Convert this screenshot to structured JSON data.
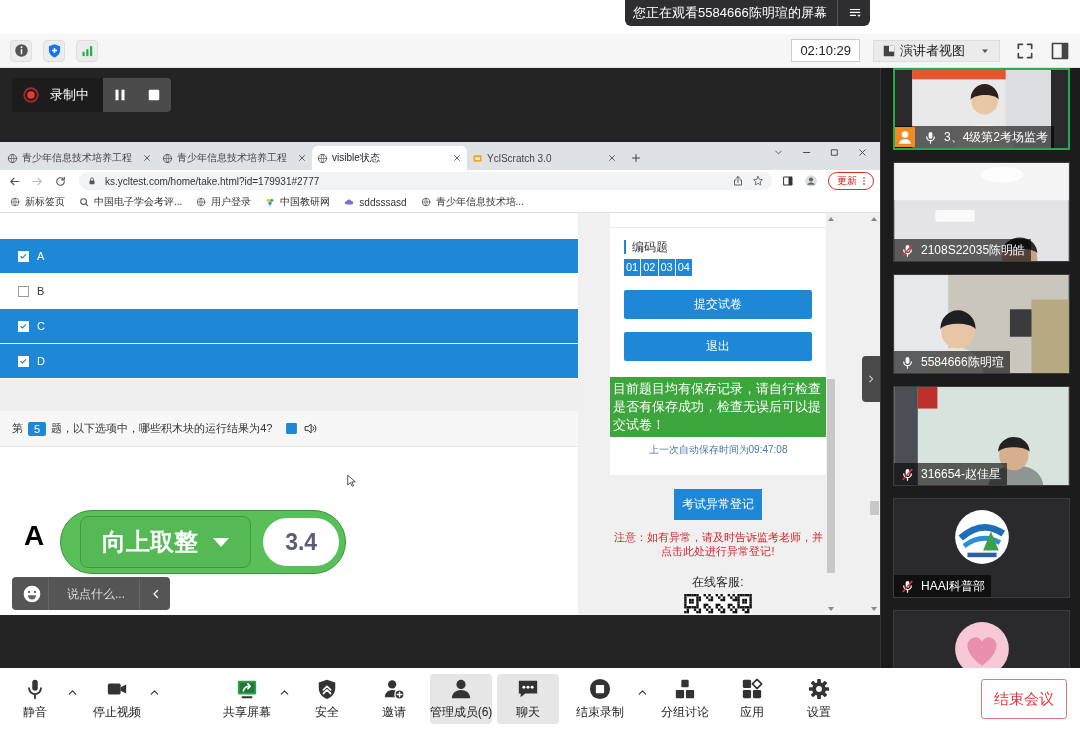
{
  "viewing_banner": {
    "text": "您正在观看5584666陈明瑄的屏幕"
  },
  "meeting_bar": {
    "timer": "02:10:29",
    "view_mode": "演讲者视图"
  },
  "recording": {
    "label": "录制中"
  },
  "browser": {
    "tabs": [
      {
        "title": "青少年信息技术培养工程",
        "kind": "globe",
        "selected": false
      },
      {
        "title": "青少年信息技术培养工程",
        "kind": "globe",
        "selected": false
      },
      {
        "title": "visible状态",
        "kind": "globe",
        "selected": true
      },
      {
        "title": "YclScratch 3.0",
        "kind": "app",
        "selected": false
      }
    ],
    "url": "ks.ycltest.com/home/take.html?id=179931#2777",
    "update_button": "更新",
    "bookmarks": [
      {
        "label": "新标签页",
        "kind": "globe"
      },
      {
        "label": "中国电子学会考评...",
        "kind": "magnifier"
      },
      {
        "label": "用户登录",
        "kind": "globe"
      },
      {
        "label": "中国教研网",
        "kind": "flower"
      },
      {
        "label": "sddsssasd",
        "kind": "cloud"
      },
      {
        "label": "青少年信息技术培...",
        "kind": "globe"
      }
    ]
  },
  "exam": {
    "options": [
      {
        "label": "A",
        "checked": true
      },
      {
        "label": "B",
        "checked": false
      },
      {
        "label": "C",
        "checked": true
      },
      {
        "label": "D",
        "checked": true
      }
    ],
    "question": {
      "prefix": "第",
      "number": "5",
      "text": "题，以下选项中，哪些积木块的运行结果为4?"
    },
    "answer_option": "A",
    "block": {
      "operator": "向上取整",
      "value": "3.4"
    },
    "chat_input": {
      "placeholder": "说点什么..."
    }
  },
  "side_panel": {
    "section_title": "编码题",
    "question_numbers": [
      "01",
      "02",
      "03",
      "04"
    ],
    "submit_button": "提交试卷",
    "exit_button": "退出",
    "save_notice": "目前题目均有保存记录，请自行检查是否有保存成功，检查无误后可以提交试卷！",
    "autosave_time": "上一次自动保存时间为09:47:08",
    "report_button": "考试异常登记",
    "warning": "注意：如有异常，请及时告诉监考老师，并点击此处进行异常登记!",
    "support_label": "在线客服:"
  },
  "participants": [
    {
      "name": "3、4级第2考场监考",
      "kind": "video",
      "muted": false,
      "host": true,
      "active": true
    },
    {
      "name": "2108S22035陈明皓",
      "kind": "video",
      "muted": true,
      "host": false,
      "active": false
    },
    {
      "name": "5584666陈明瑄",
      "kind": "video",
      "muted": false,
      "host": false,
      "active": false
    },
    {
      "name": "316654-赵佳星",
      "kind": "video",
      "muted": true,
      "host": false,
      "active": false
    },
    {
      "name": "HAAI科普部",
      "kind": "logo",
      "muted": true,
      "host": false,
      "active": false
    },
    {
      "kind": "avatar"
    }
  ],
  "toolbar": [
    {
      "label": "静音",
      "kind": "mic",
      "menu": true,
      "selected": false
    },
    {
      "label": "停止视频",
      "kind": "camera",
      "menu": true,
      "selected": false
    },
    {
      "label": "共享屏幕",
      "kind": "share",
      "menu": true,
      "selected": false
    },
    {
      "label": "安全",
      "kind": "shield",
      "menu": false,
      "selected": false
    },
    {
      "label": "邀请",
      "kind": "invite",
      "menu": false,
      "selected": false
    },
    {
      "label": "管理成员(6)",
      "kind": "members",
      "menu": false,
      "selected": true
    },
    {
      "label": "聊天",
      "kind": "chat",
      "menu": false,
      "selected": true
    },
    {
      "label": "结束录制",
      "kind": "stop",
      "menu": true,
      "selected": false
    },
    {
      "label": "分组讨论",
      "kind": "groups",
      "menu": false,
      "selected": false
    },
    {
      "label": "应用",
      "kind": "apps",
      "menu": false,
      "selected": false
    },
    {
      "label": "设置",
      "kind": "gear",
      "menu": false,
      "selected": false
    }
  ],
  "end_button": "结束会议"
}
